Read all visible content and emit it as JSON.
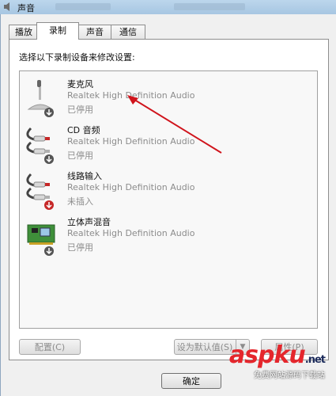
{
  "window": {
    "title": "声音"
  },
  "tabs": [
    {
      "label": "播放",
      "active": false
    },
    {
      "label": "录制",
      "active": true
    },
    {
      "label": "声音",
      "active": false
    },
    {
      "label": "通信",
      "active": false
    }
  ],
  "instruction": "选择以下录制设备来修改设置:",
  "devices": [
    {
      "name": "麦克风",
      "driver": "Realtek High Definition Audio",
      "status": "已停用",
      "icon": "microphone-icon",
      "badge": "disabled-down-arrow"
    },
    {
      "name": "CD 音频",
      "driver": "Realtek High Definition Audio",
      "status": "已停用",
      "icon": "cd-audio-cable-icon",
      "badge": "disabled-down-arrow"
    },
    {
      "name": "线路输入",
      "driver": "Realtek High Definition Audio",
      "status": "未插入",
      "icon": "line-in-cable-icon",
      "badge": "unplugged-red-arrow"
    },
    {
      "name": "立体声混音",
      "driver": "Realtek High Definition Audio",
      "status": "已停用",
      "icon": "sound-card-icon",
      "badge": "disabled-down-arrow"
    }
  ],
  "buttons": {
    "configure": "配置(C)",
    "set_default": "设为默认值(S)",
    "properties": "属性(P)",
    "ok": "确定"
  },
  "watermark": {
    "brand": "aspku",
    "tld": ".net",
    "sub": "免费网站源码下载站"
  },
  "colors": {
    "annotation_arrow": "#d0141c",
    "watermark_red": "#e5262c",
    "watermark_navy": "#1b2a5a"
  }
}
